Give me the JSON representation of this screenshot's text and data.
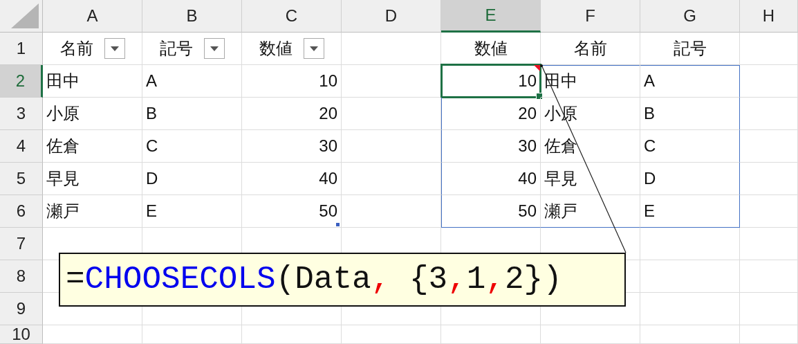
{
  "columns": [
    {
      "label": "A",
      "selected": false
    },
    {
      "label": "B",
      "selected": false
    },
    {
      "label": "C",
      "selected": false
    },
    {
      "label": "D",
      "selected": false
    },
    {
      "label": "E",
      "selected": true
    },
    {
      "label": "F",
      "selected": false
    },
    {
      "label": "G",
      "selected": false
    },
    {
      "label": "H",
      "selected": false
    }
  ],
  "rows": [
    {
      "label": "1",
      "selected": false,
      "cells": [
        {
          "text": "名前",
          "kind": "filter"
        },
        {
          "text": "記号",
          "kind": "filter"
        },
        {
          "text": "数値",
          "kind": "filter"
        },
        {},
        {
          "text": "数値",
          "kind": "header"
        },
        {
          "text": "名前",
          "kind": "header"
        },
        {
          "text": "記号",
          "kind": "header"
        },
        {}
      ]
    },
    {
      "label": "2",
      "selected": true,
      "cells": [
        {
          "text": "田中",
          "kind": "text"
        },
        {
          "text": "A",
          "kind": "text"
        },
        {
          "text": "10",
          "kind": "number"
        },
        {},
        {
          "text": "10",
          "kind": "number",
          "active": true,
          "comment": true,
          "spill": true
        },
        {
          "text": "田中",
          "kind": "text",
          "spill": true
        },
        {
          "text": "A",
          "kind": "text",
          "spill": true
        },
        {}
      ]
    },
    {
      "label": "3",
      "selected": false,
      "cells": [
        {
          "text": "小原",
          "kind": "text"
        },
        {
          "text": "B",
          "kind": "text"
        },
        {
          "text": "20",
          "kind": "number"
        },
        {},
        {
          "text": "20",
          "kind": "number",
          "spill": true
        },
        {
          "text": "小原",
          "kind": "text",
          "spill": true
        },
        {
          "text": "B",
          "kind": "text",
          "spill": true
        },
        {}
      ]
    },
    {
      "label": "4",
      "selected": false,
      "cells": [
        {
          "text": "佐倉",
          "kind": "text"
        },
        {
          "text": "C",
          "kind": "text"
        },
        {
          "text": "30",
          "kind": "number"
        },
        {},
        {
          "text": "30",
          "kind": "number",
          "spill": true
        },
        {
          "text": "佐倉",
          "kind": "text",
          "spill": true
        },
        {
          "text": "C",
          "kind": "text",
          "spill": true
        },
        {}
      ]
    },
    {
      "label": "5",
      "selected": false,
      "cells": [
        {
          "text": "早見",
          "kind": "text"
        },
        {
          "text": "D",
          "kind": "text"
        },
        {
          "text": "40",
          "kind": "number"
        },
        {},
        {
          "text": "40",
          "kind": "number",
          "spill": true
        },
        {
          "text": "早見",
          "kind": "text",
          "spill": true
        },
        {
          "text": "D",
          "kind": "text",
          "spill": true
        },
        {}
      ]
    },
    {
      "label": "6",
      "selected": false,
      "cells": [
        {
          "text": "瀬戸",
          "kind": "text"
        },
        {
          "text": "E",
          "kind": "text"
        },
        {
          "text": "50",
          "kind": "number",
          "table_end": true
        },
        {},
        {
          "text": "50",
          "kind": "number",
          "spill": true
        },
        {
          "text": "瀬戸",
          "kind": "text",
          "spill": true
        },
        {
          "text": "E",
          "kind": "text",
          "spill": true
        },
        {}
      ]
    },
    {
      "label": "7",
      "selected": false,
      "cells": [
        {},
        {},
        {},
        {},
        {},
        {},
        {},
        {}
      ]
    },
    {
      "label": "8",
      "selected": false,
      "cells": [
        {},
        {},
        {},
        {},
        {},
        {},
        {},
        {}
      ]
    },
    {
      "label": "9",
      "selected": false,
      "cells": [
        {},
        {},
        {},
        {},
        {},
        {},
        {},
        {}
      ]
    },
    {
      "label": "10",
      "selected": false,
      "cells": [
        {},
        {},
        {},
        {},
        {},
        {},
        {},
        {}
      ]
    }
  ],
  "callout": {
    "segments": [
      {
        "text": "=",
        "kind": "plain"
      },
      {
        "text": "CHOOSECOLS",
        "kind": "function"
      },
      {
        "text": "(Data",
        "kind": "plain"
      },
      {
        "text": ",",
        "kind": "separator"
      },
      {
        "text": " {3",
        "kind": "plain"
      },
      {
        "text": ",",
        "kind": "separator"
      },
      {
        "text": "1",
        "kind": "plain"
      },
      {
        "text": ",",
        "kind": "separator"
      },
      {
        "text": "2})",
        "kind": "plain"
      }
    ]
  }
}
